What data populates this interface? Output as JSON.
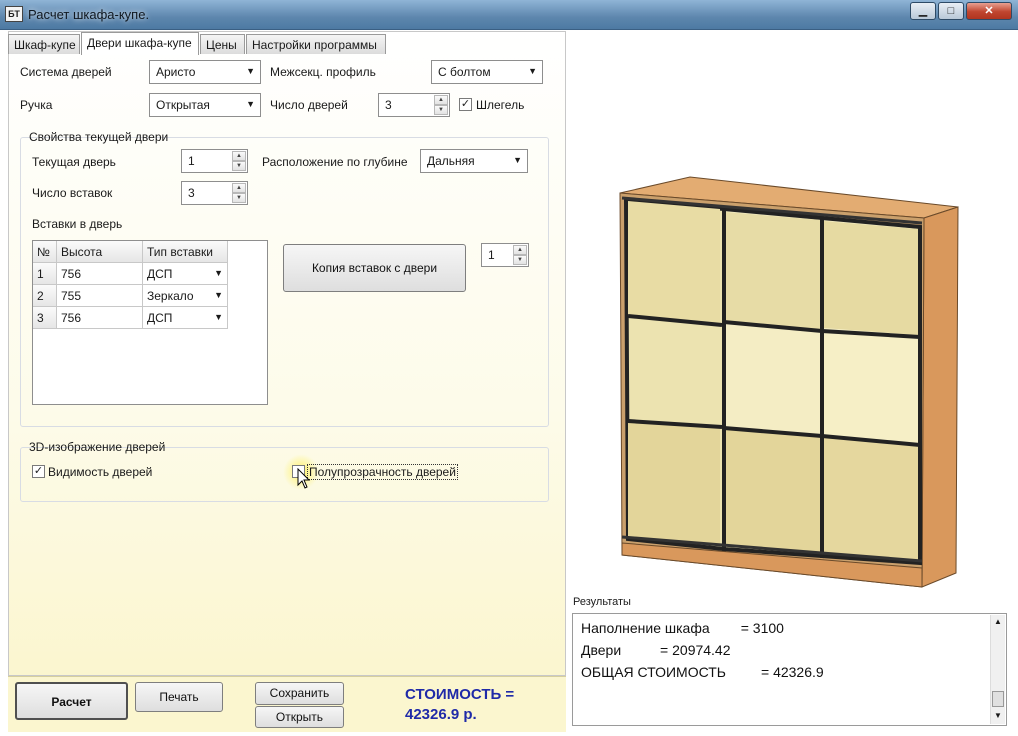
{
  "window": {
    "icon_text": "БТ",
    "title": "Расчет шкафа-купе.",
    "minimize": "▁",
    "maximize": "□",
    "close": "✕"
  },
  "tabs": [
    {
      "label": "Шкаф-купе"
    },
    {
      "label": "Двери шкафа-купе",
      "active": true
    },
    {
      "label": "Цены"
    },
    {
      "label": "Настройки программы"
    }
  ],
  "doors": {
    "system_label": "Система дверей",
    "system_value": "Аристо",
    "profile_label": "Межсекц. профиль",
    "profile_value": "С болтом",
    "handle_label": "Ручка",
    "handle_value": "Открытая",
    "count_label": "Число дверей",
    "count_value": "3",
    "schlegel_label": "Шлегель",
    "schlegel_checked": true
  },
  "current_door": {
    "group_title": "Свойства текущей двери",
    "current_label": "Текущая дверь",
    "current_value": "1",
    "depth_label": "Расположение по глубине",
    "depth_value": "Дальняя",
    "inserts_count_label": "Число вставок",
    "inserts_count_value": "3",
    "inserts_label": "Вставки в дверь",
    "grid_headers": [
      "№",
      "Высота",
      "Тип вставки"
    ],
    "rows": [
      {
        "num": "1",
        "height": "756",
        "type": "ДСП"
      },
      {
        "num": "2",
        "height": "755",
        "type": "Зеркало"
      },
      {
        "num": "3",
        "height": "756",
        "type": "ДСП"
      }
    ],
    "copy_button": "Копия вставок с двери",
    "copy_source_value": "1"
  },
  "view3d": {
    "group_title": "3D-изображение дверей",
    "visible_label": "Видимость дверей",
    "visible_checked": true,
    "transparent_label": "Полупрозрачность дверей",
    "transparent_checked": false
  },
  "buttons": {
    "calc": "Расчет",
    "print": "Печать",
    "save": "Сохранить",
    "open": "Открыть"
  },
  "cost": {
    "line1": "СТОИМОСТЬ =",
    "line2": "42326.9 р."
  },
  "results": {
    "title": "Результаты",
    "lines": [
      "Наполнение шкафа        = 3100",
      "Двери          = 20974.42",
      "ОБЩАЯ СТОИМОСТЬ         = 42326.9"
    ]
  },
  "colors": {
    "cost_text": "#1f2aa8",
    "panel_yellow": "#fbf6cf",
    "wood": "#d9a06a"
  }
}
